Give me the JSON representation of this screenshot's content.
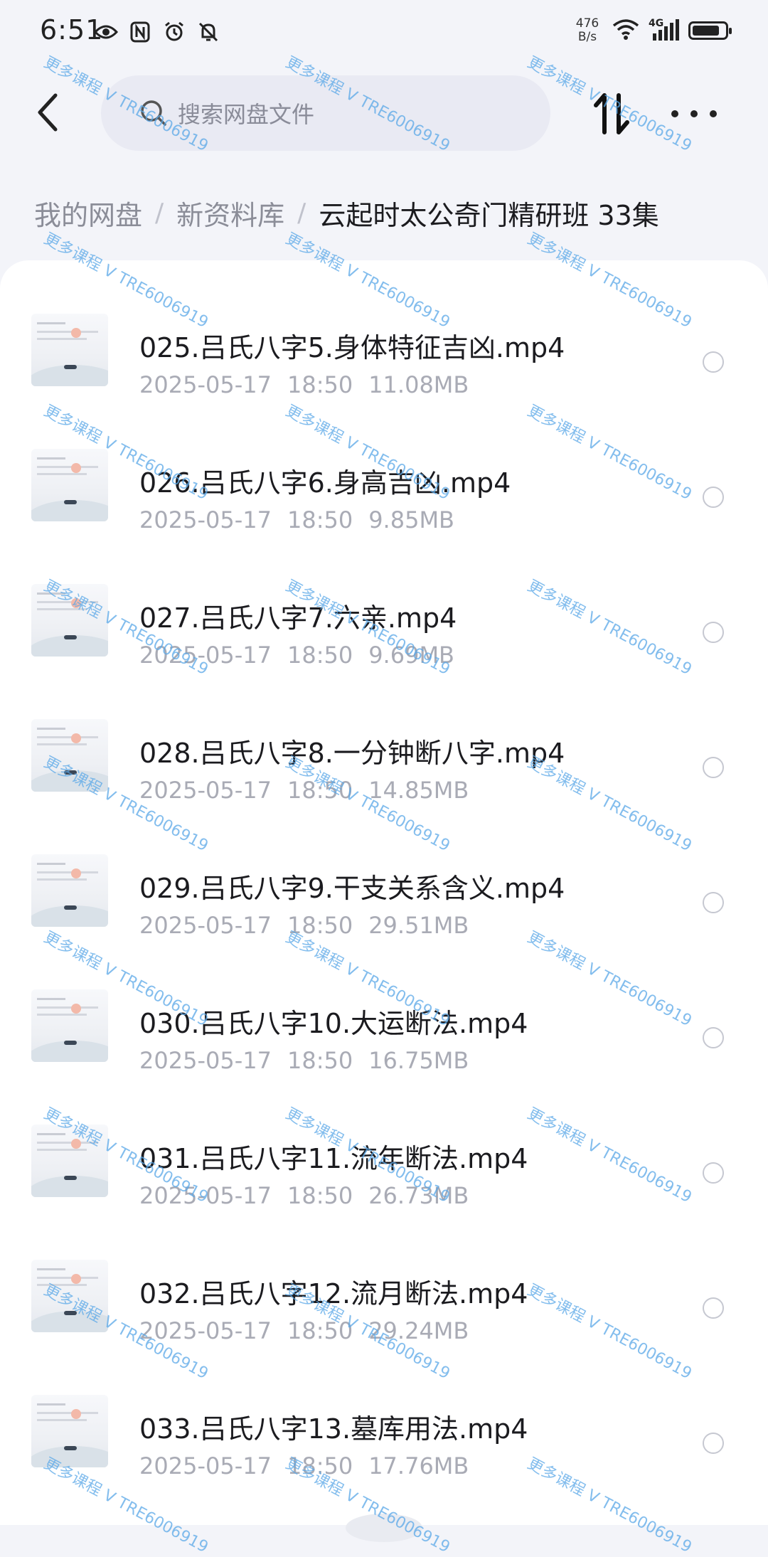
{
  "status_bar": {
    "time": "6:51",
    "net_speed_value": "476",
    "net_speed_unit": "B/s",
    "network_type": "4G",
    "left_icons": [
      "eye-icon",
      "nfc-icon",
      "alarm-icon",
      "mute-bell-icon"
    ],
    "battery_level": 0.85
  },
  "header": {
    "search_placeholder": "搜索网盘文件"
  },
  "breadcrumb": {
    "items": [
      "我的网盘",
      "新资料库",
      "云起时太公奇门精研班 33集"
    ],
    "separator": "/"
  },
  "files": [
    {
      "name": "025.吕氏八字5.身体特征吉凶.mp4",
      "date": "2025-05-17",
      "time": "18:50",
      "size": "11.08MB"
    },
    {
      "name": "026.吕氏八字6.身高吉凶.mp4",
      "date": "2025-05-17",
      "time": "18:50",
      "size": "9.85MB"
    },
    {
      "name": "027.吕氏八字7.六亲.mp4",
      "date": "2025-05-17",
      "time": "18:50",
      "size": "9.69MB"
    },
    {
      "name": "028.吕氏八字8.一分钟断八字.mp4",
      "date": "2025-05-17",
      "time": "18:50",
      "size": "14.85MB"
    },
    {
      "name": "029.吕氏八字9.干支关系含义.mp4",
      "date": "2025-05-17",
      "time": "18:50",
      "size": "29.51MB"
    },
    {
      "name": "030.吕氏八字10.大运断法.mp4",
      "date": "2025-05-17",
      "time": "18:50",
      "size": "16.75MB"
    },
    {
      "name": "031.吕氏八字11.流年断法.mp4",
      "date": "2025-05-17",
      "time": "18:50",
      "size": "26.73MB"
    },
    {
      "name": "032.吕氏八字12.流月断法.mp4",
      "date": "2025-05-17",
      "time": "18:50",
      "size": "29.24MB"
    },
    {
      "name": "033.吕氏八字13.墓库用法.mp4",
      "date": "2025-05-17",
      "time": "18:50",
      "size": "17.76MB"
    }
  ],
  "watermark": "更多课程 V TRE6006919",
  "colors": {
    "background": "#f3f4f9",
    "panel": "#ffffff",
    "watermark": "#5aa8e8",
    "meta_text": "#a9abb5"
  }
}
